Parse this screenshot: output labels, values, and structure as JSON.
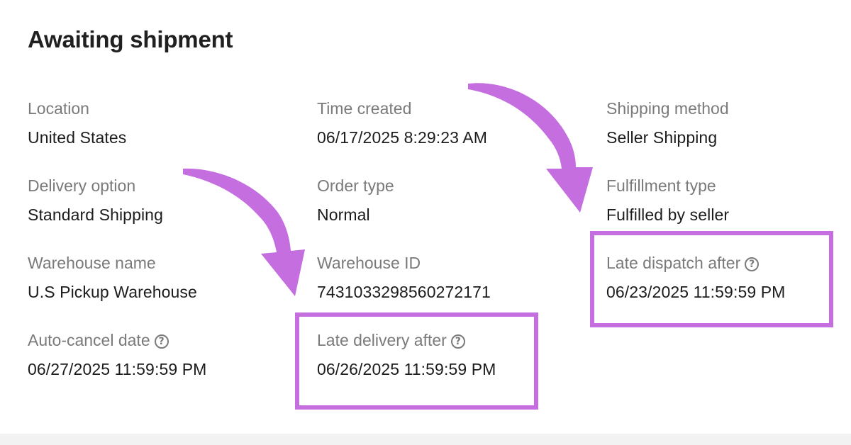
{
  "page": {
    "title": "Awaiting shipment"
  },
  "fields": {
    "location": {
      "label": "Location",
      "value": "United States"
    },
    "time_created": {
      "label": "Time created",
      "value": "06/17/2025 8:29:23 AM"
    },
    "shipping_method": {
      "label": "Shipping method",
      "value": "Seller Shipping"
    },
    "delivery_option": {
      "label": "Delivery option",
      "value": "Standard Shipping"
    },
    "order_type": {
      "label": "Order type",
      "value": "Normal"
    },
    "fulfillment_type": {
      "label": "Fulfillment type",
      "value": "Fulfilled by seller"
    },
    "warehouse_name": {
      "label": "Warehouse name",
      "value": "U.S Pickup Warehouse"
    },
    "warehouse_id": {
      "label": "Warehouse ID",
      "value": "7431033298560272171"
    },
    "late_dispatch": {
      "label": "Late dispatch after",
      "value": "06/23/2025 11:59:59 PM",
      "icon": "help-circle-icon"
    },
    "auto_cancel": {
      "label": "Auto-cancel date",
      "value": "06/27/2025 11:59:59 PM",
      "icon": "help-circle-icon"
    },
    "late_delivery": {
      "label": "Late delivery after",
      "value": "06/26/2025 11:59:59 PM",
      "icon": "help-circle-icon"
    }
  },
  "icons": {
    "help_glyph": "?"
  },
  "colors": {
    "highlight": "#c46ee0",
    "label_text": "#7a7a7a",
    "value_text": "#1c1c1c",
    "bottom_strip": "#f2f2f3"
  }
}
